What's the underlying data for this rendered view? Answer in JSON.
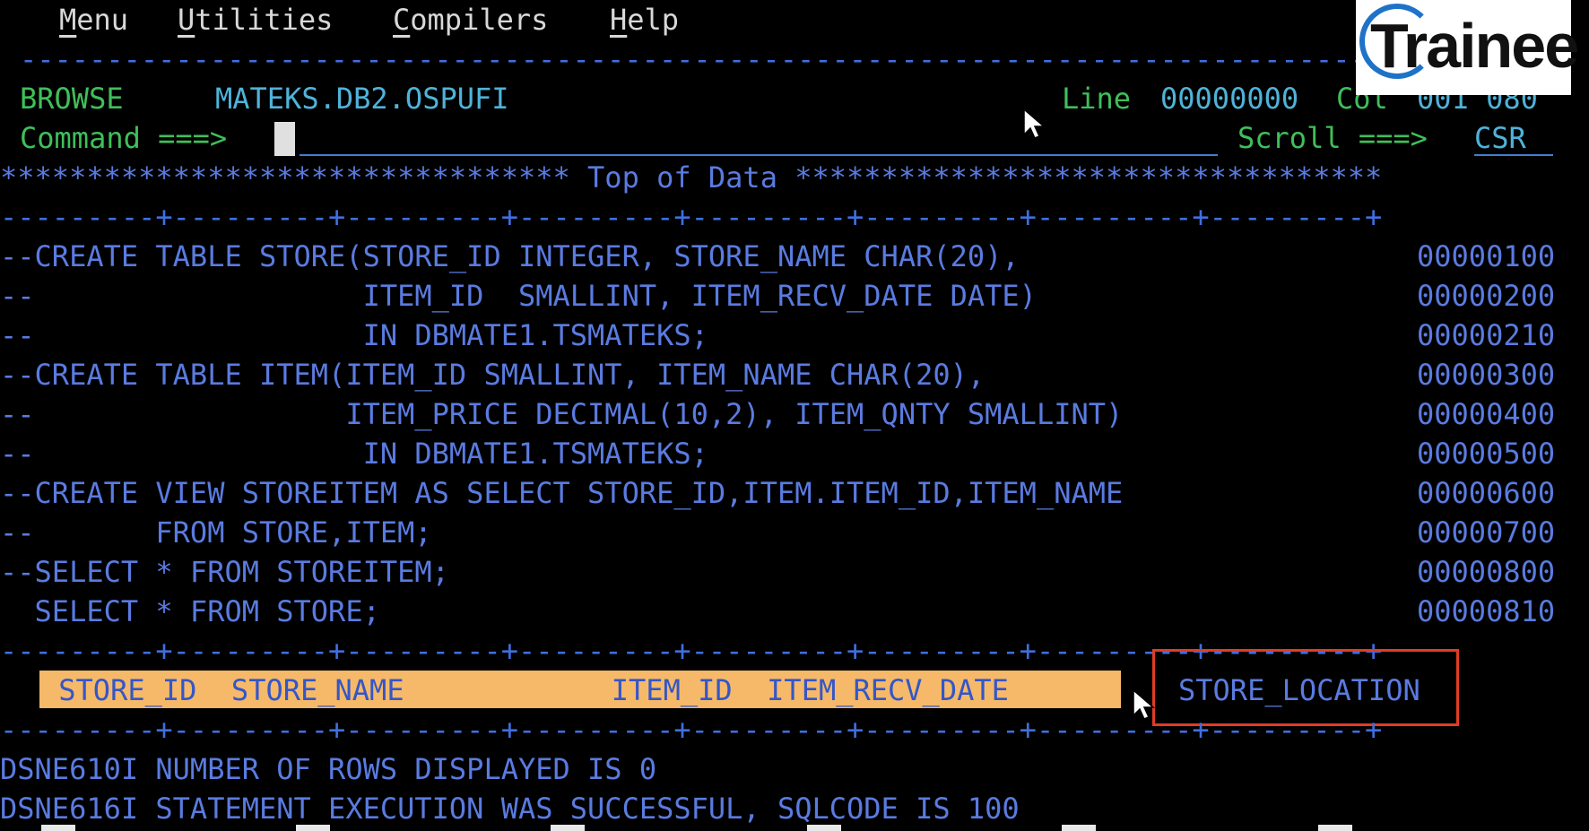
{
  "menu": {
    "items": [
      {
        "first": "M",
        "rest": "enu"
      },
      {
        "first": "U",
        "rest": "tilities"
      },
      {
        "first": "C",
        "rest": "ompilers"
      },
      {
        "first": "H",
        "rest": "elp"
      }
    ]
  },
  "separator_top": "-------------------------------------------------------------------------------",
  "status": {
    "mode": "BROWSE",
    "dataset": "MATEKS.DB2.OSPUFI",
    "line_label": "Line",
    "line_value": "00000000",
    "col_label": "Col",
    "col_value": "001 080"
  },
  "command": {
    "label": "Command ===>",
    "value": "",
    "scroll_label": "Scroll ===>",
    "scroll_value": "CSR"
  },
  "top_of_data": "********************************* Top of Data **********************************",
  "ruler": "---------+---------+---------+---------+---------+---------+---------+---------+",
  "code_lines": [
    {
      "text": "--CREATE TABLE STORE(STORE_ID INTEGER, STORE_NAME CHAR(20),",
      "seq": "00000100"
    },
    {
      "text": "--                   ITEM_ID  SMALLINT, ITEM_RECV_DATE DATE)",
      "seq": "00000200"
    },
    {
      "text": "--                   IN DBMATE1.TSMATEKS;",
      "seq": "00000210"
    },
    {
      "text": "--CREATE TABLE ITEM(ITEM_ID SMALLINT, ITEM_NAME CHAR(20),",
      "seq": "00000300"
    },
    {
      "text": "--                  ITEM_PRICE DECIMAL(10,2), ITEM_QNTY SMALLINT)",
      "seq": "00000400"
    },
    {
      "text": "--                   IN DBMATE1.TSMATEKS;",
      "seq": "00000500"
    },
    {
      "text": "--CREATE VIEW STOREITEM AS SELECT STORE_ID,ITEM.ITEM_ID,ITEM_NAME",
      "seq": "00000600"
    },
    {
      "text": "--       FROM STORE,ITEM;",
      "seq": "00000700"
    },
    {
      "text": "--SELECT * FROM STOREITEM;",
      "seq": "00000800"
    },
    {
      "text": "  SELECT * FROM STORE;",
      "seq": "00000810"
    }
  ],
  "result_header": {
    "columns_text": " STORE_ID  STORE_NAME            ITEM_ID  ITEM_RECV_DATE",
    "highlighted_column": "STORE_LOCATION"
  },
  "messages": [
    "DSNE610I NUMBER OF ROWS DISPLAYED IS 0",
    "DSNE616I STATEMENT EXECUTION WAS SUCCESSFUL, SQLCODE IS 100"
  ],
  "logo": {
    "text": "Trainee"
  },
  "colors": {
    "background": "#000000",
    "green": "#3fbf5a",
    "cyan": "#4fb3d9",
    "blue": "#5a7be0",
    "highlight_band": "#f5b969",
    "highlight_box": "#e23b25"
  }
}
